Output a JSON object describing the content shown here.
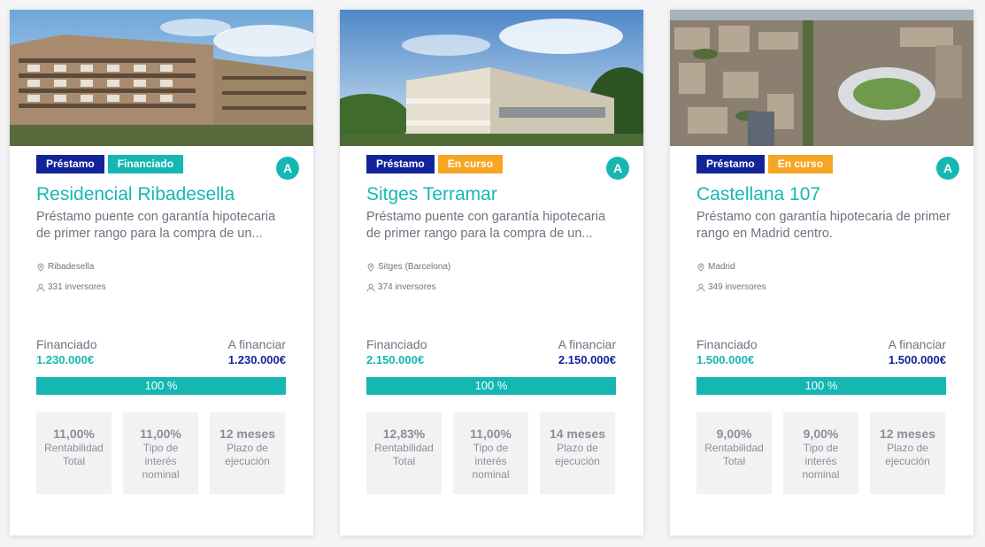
{
  "colors": {
    "accent": "#16b7b3",
    "navy": "#13249a",
    "orange": "#f5a623",
    "text_gray": "#6e7380"
  },
  "cards": [
    {
      "type_tag": "Préstamo",
      "status_tag": "Financiado",
      "rating": "A",
      "title": "Residencial Ribadesella",
      "description": "Préstamo puente con garantía hipotecaria de primer rango para la compra de un...",
      "location": "Ribadesella",
      "investors": "331 inversores",
      "financed_label": "Financiado",
      "to_finance_label": "A financiar",
      "financed_amount": "1.230.000€",
      "to_finance_amount": "1.230.000€",
      "progress_percent": 100,
      "progress_label": "100 %",
      "stats": [
        {
          "value": "11,00%",
          "label": "Rentabilidad Total"
        },
        {
          "value": "11,00%",
          "label": "Tipo de interés nominal"
        },
        {
          "value": "12 meses",
          "label": "Plazo de ejecución"
        }
      ]
    },
    {
      "type_tag": "Préstamo",
      "status_tag": "En curso",
      "rating": "A",
      "title": "Sitges Terramar",
      "description": "Préstamo puente con garantía hipotecaria de primer rango para la compra de un...",
      "location": "Sitges (Barcelona)",
      "investors": "374 inversores",
      "financed_label": "Financiado",
      "to_finance_label": "A financiar",
      "financed_amount": "2.150.000€",
      "to_finance_amount": "2.150.000€",
      "progress_percent": 100,
      "progress_label": "100 %",
      "stats": [
        {
          "value": "12,83%",
          "label": "Rentabilidad Total"
        },
        {
          "value": "11,00%",
          "label": "Tipo de interés nominal"
        },
        {
          "value": "14 meses",
          "label": "Plazo de ejecución"
        }
      ]
    },
    {
      "type_tag": "Préstamo",
      "status_tag": "En curso",
      "rating": "A",
      "title": "Castellana 107",
      "description": "Préstamo con garantía hipotecaria de primer rango en Madrid centro.",
      "location": "Madrid",
      "investors": "349 inversores",
      "financed_label": "Financiado",
      "to_finance_label": "A financiar",
      "financed_amount": "1.500.000€",
      "to_finance_amount": "1.500.000€",
      "progress_percent": 100,
      "progress_label": "100 %",
      "stats": [
        {
          "value": "9,00%",
          "label": "Rentabilidad Total"
        },
        {
          "value": "9,00%",
          "label": "Tipo de interés nominal"
        },
        {
          "value": "12 meses",
          "label": "Plazo de ejecución"
        }
      ]
    }
  ]
}
